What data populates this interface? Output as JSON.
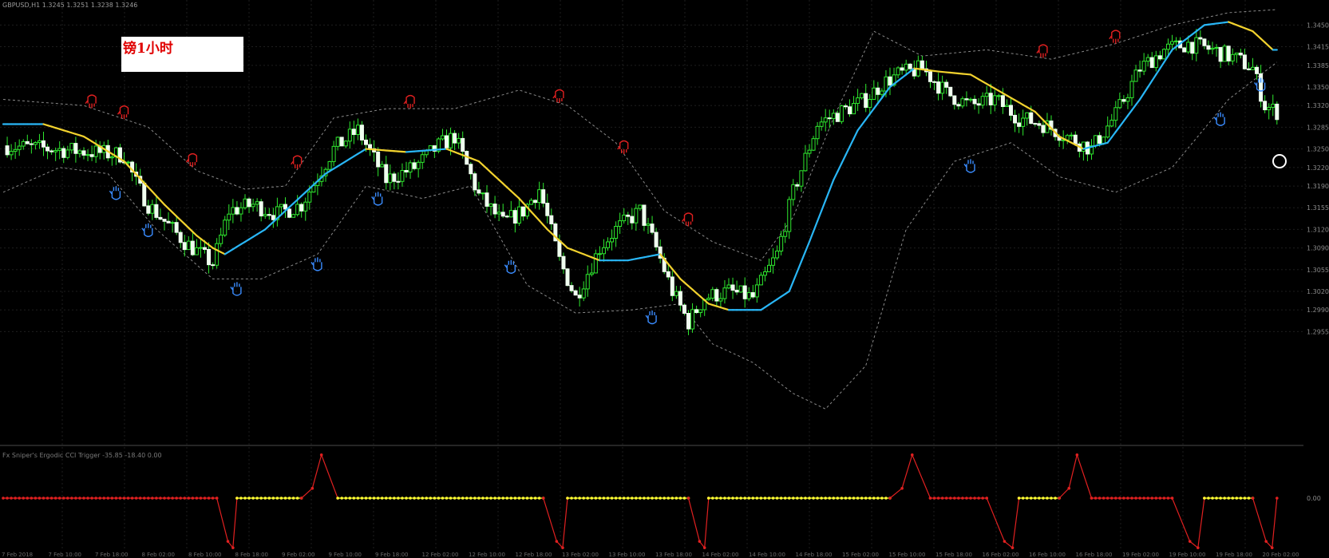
{
  "header": {
    "symbol_info": "GBPUSD,H1  1.3245 1.3251 1.3238 1.3246",
    "indicator_label": "Fx Sniper's Ergodic CCI Trigger -35.85 -18.40 0.00"
  },
  "overlay": {
    "title": "镑1小时"
  },
  "colors": {
    "background": "#000000",
    "bull_candle": "#2ee82e",
    "bear_candle": "#f0fff0",
    "wick": "#2ee82e",
    "ma_up": "#29b6f6",
    "ma_down": "#f2d22e",
    "band": "#8a8a8a",
    "osc_high": "#e02020",
    "osc_mid": "#ffff33"
  },
  "chart_data": [
    {
      "type": "candlestick",
      "name": "price",
      "ylim": [
        1.2775,
        1.3475
      ],
      "yticks": [
        "1.3450",
        "1.3415",
        "1.3385",
        "1.3350",
        "1.3320",
        "1.3285",
        "1.3250",
        "1.3220",
        "1.3190",
        "1.3155",
        "1.3120",
        "1.3090",
        "1.3055",
        "1.3020",
        "1.2990",
        "1.2955"
      ],
      "close_path": [
        [
          0,
          1.3255
        ],
        [
          12,
          1.325
        ],
        [
          22,
          1.3245
        ],
        [
          30,
          1.324
        ],
        [
          33,
          1.3195
        ],
        [
          36,
          1.316
        ],
        [
          42,
          1.312
        ],
        [
          45,
          1.31
        ],
        [
          52,
          1.3065
        ],
        [
          56,
          1.315
        ],
        [
          62,
          1.316
        ],
        [
          68,
          1.3145
        ],
        [
          74,
          1.316
        ],
        [
          82,
          1.325
        ],
        [
          88,
          1.328
        ],
        [
          95,
          1.32
        ],
        [
          102,
          1.322
        ],
        [
          108,
          1.3255
        ],
        [
          112,
          1.327
        ],
        [
          118,
          1.3175
        ],
        [
          124,
          1.313
        ],
        [
          129,
          1.315
        ],
        [
          133,
          1.3185
        ],
        [
          138,
          1.307
        ],
        [
          142,
          1.301
        ],
        [
          148,
          1.309
        ],
        [
          152,
          1.312
        ],
        [
          158,
          1.315
        ],
        [
          162,
          1.309
        ],
        [
          166,
          1.302
        ],
        [
          170,
          1.297
        ],
        [
          174,
          1.301
        ],
        [
          180,
          1.302
        ],
        [
          186,
          1.301
        ],
        [
          192,
          1.308
        ],
        [
          196,
          1.318
        ],
        [
          202,
          1.329
        ],
        [
          208,
          1.331
        ],
        [
          214,
          1.333
        ],
        [
          218,
          1.3355
        ],
        [
          222,
          1.337
        ],
        [
          228,
          1.338
        ],
        [
          234,
          1.334
        ],
        [
          240,
          1.332
        ],
        [
          246,
          1.333
        ],
        [
          252,
          1.33
        ],
        [
          258,
          1.329
        ],
        [
          264,
          1.327
        ],
        [
          270,
          1.325
        ],
        [
          276,
          1.3305
        ],
        [
          282,
          1.338
        ],
        [
          288,
          1.341
        ],
        [
          294,
          1.342
        ],
        [
          300,
          1.341
        ],
        [
          306,
          1.3395
        ],
        [
          310,
          1.338
        ],
        [
          313,
          1.332
        ],
        [
          316,
          1.331
        ]
      ],
      "ma_path": [
        [
          0,
          1.329
        ],
        [
          10,
          1.329
        ],
        [
          20,
          1.327
        ],
        [
          30,
          1.323
        ],
        [
          40,
          1.316
        ],
        [
          48,
          1.311
        ],
        [
          52,
          1.309
        ],
        [
          55,
          1.308
        ],
        [
          65,
          1.312
        ],
        [
          80,
          1.321
        ],
        [
          90,
          1.325
        ],
        [
          100,
          1.3245
        ],
        [
          110,
          1.325
        ],
        [
          118,
          1.323
        ],
        [
          128,
          1.317
        ],
        [
          135,
          1.312
        ],
        [
          140,
          1.309
        ],
        [
          148,
          1.307
        ],
        [
          155,
          1.307
        ],
        [
          163,
          1.308
        ],
        [
          168,
          1.304
        ],
        [
          175,
          1.3
        ],
        [
          180,
          1.299
        ],
        [
          188,
          1.299
        ],
        [
          195,
          1.302
        ],
        [
          200,
          1.31
        ],
        [
          206,
          1.32
        ],
        [
          212,
          1.328
        ],
        [
          220,
          1.335
        ],
        [
          226,
          1.338
        ],
        [
          232,
          1.3375
        ],
        [
          240,
          1.337
        ],
        [
          248,
          1.334
        ],
        [
          256,
          1.331
        ],
        [
          262,
          1.327
        ],
        [
          268,
          1.325
        ],
        [
          274,
          1.326
        ],
        [
          282,
          1.333
        ],
        [
          290,
          1.341
        ],
        [
          298,
          1.345
        ],
        [
          304,
          1.3455
        ],
        [
          310,
          1.344
        ],
        [
          315,
          1.341
        ]
      ],
      "band_upper": [
        [
          0,
          1.333
        ],
        [
          20,
          1.332
        ],
        [
          36,
          1.3285
        ],
        [
          48,
          1.3215
        ],
        [
          60,
          1.3185
        ],
        [
          70,
          1.319
        ],
        [
          82,
          1.33
        ],
        [
          95,
          1.3315
        ],
        [
          112,
          1.3315
        ],
        [
          128,
          1.3345
        ],
        [
          140,
          1.332
        ],
        [
          152,
          1.326
        ],
        [
          164,
          1.315
        ],
        [
          176,
          1.31
        ],
        [
          188,
          1.307
        ],
        [
          196,
          1.314
        ],
        [
          206,
          1.33
        ],
        [
          216,
          1.344
        ],
        [
          228,
          1.34
        ],
        [
          244,
          1.341
        ],
        [
          260,
          1.3395
        ],
        [
          276,
          1.342
        ],
        [
          290,
          1.345
        ],
        [
          304,
          1.347
        ],
        [
          316,
          1.3475
        ]
      ],
      "band_lower": [
        [
          0,
          1.318
        ],
        [
          14,
          1.322
        ],
        [
          26,
          1.321
        ],
        [
          38,
          1.312
        ],
        [
          52,
          1.304
        ],
        [
          64,
          1.304
        ],
        [
          78,
          1.308
        ],
        [
          90,
          1.319
        ],
        [
          104,
          1.317
        ],
        [
          116,
          1.319
        ],
        [
          130,
          1.303
        ],
        [
          142,
          1.2985
        ],
        [
          156,
          1.299
        ],
        [
          168,
          1.3
        ],
        [
          176,
          1.2935
        ],
        [
          186,
          1.2905
        ],
        [
          196,
          1.2855
        ],
        [
          204,
          1.283
        ],
        [
          214,
          1.29
        ],
        [
          224,
          1.312
        ],
        [
          236,
          1.323
        ],
        [
          250,
          1.326
        ],
        [
          262,
          1.3205
        ],
        [
          276,
          1.318
        ],
        [
          290,
          1.322
        ],
        [
          304,
          1.333
        ],
        [
          316,
          1.339
        ]
      ],
      "signals_up": [
        28,
        36,
        58,
        78,
        93,
        126,
        161,
        240,
        302,
        312
      ],
      "signals_down": [
        22,
        30,
        47,
        73,
        101,
        138,
        154,
        170,
        258,
        276
      ]
    },
    {
      "type": "line",
      "name": "oscillator",
      "ylim": [
        -1.3,
        1.3
      ],
      "yticks": [
        "0.00"
      ],
      "segments": [
        {
          "from": 0,
          "to": 53,
          "level": 0,
          "color": "red"
        },
        {
          "from": 53,
          "to": 58,
          "shape": "down-spike",
          "color": "red"
        },
        {
          "from": 58,
          "to": 74,
          "level": 0,
          "color": "yellow"
        },
        {
          "from": 74,
          "to": 83,
          "shape": "up-spike",
          "color": "red"
        },
        {
          "from": 83,
          "to": 134,
          "level": 0,
          "color": "yellow"
        },
        {
          "from": 134,
          "to": 140,
          "shape": "down-spike",
          "color": "red"
        },
        {
          "from": 140,
          "to": 170,
          "level": 0,
          "color": "yellow"
        },
        {
          "from": 170,
          "to": 175,
          "shape": "down-spike",
          "color": "red"
        },
        {
          "from": 175,
          "to": 220,
          "level": 0,
          "color": "yellow"
        },
        {
          "from": 220,
          "to": 230,
          "shape": "up-spike",
          "color": "red"
        },
        {
          "from": 230,
          "to": 244,
          "level": 0,
          "color": "red"
        },
        {
          "from": 244,
          "to": 252,
          "shape": "down-spike",
          "color": "red"
        },
        {
          "from": 252,
          "to": 262,
          "level": 0,
          "color": "yellow"
        },
        {
          "from": 262,
          "to": 270,
          "shape": "up-spike",
          "color": "red"
        },
        {
          "from": 270,
          "to": 290,
          "level": 0,
          "color": "red"
        },
        {
          "from": 290,
          "to": 298,
          "shape": "down-spike",
          "color": "red"
        },
        {
          "from": 298,
          "to": 310,
          "level": 0,
          "color": "yellow"
        },
        {
          "from": 310,
          "to": 316,
          "shape": "down-spike",
          "color": "red"
        }
      ]
    }
  ],
  "xaxis": {
    "tick_labels": [
      "7 Feb 2018",
      "7 Feb 10:00",
      "7 Feb 18:00",
      "8 Feb 02:00",
      "8 Feb 10:00",
      "8 Feb 18:00",
      "9 Feb 02:00",
      "9 Feb 10:00",
      "9 Feb 18:00",
      "12 Feb 02:00",
      "12 Feb 10:00",
      "12 Feb 18:00",
      "13 Feb 02:00",
      "13 Feb 10:00",
      "13 Feb 18:00",
      "14 Feb 02:00",
      "14 Feb 10:00",
      "14 Feb 18:00",
      "15 Feb 02:00",
      "15 Feb 10:00",
      "15 Feb 18:00",
      "16 Feb 02:00",
      "16 Feb 10:00",
      "16 Feb 18:00",
      "19 Feb 02:00",
      "19 Feb 10:00",
      "19 Feb 18:00",
      "20 Feb 02:00"
    ]
  }
}
